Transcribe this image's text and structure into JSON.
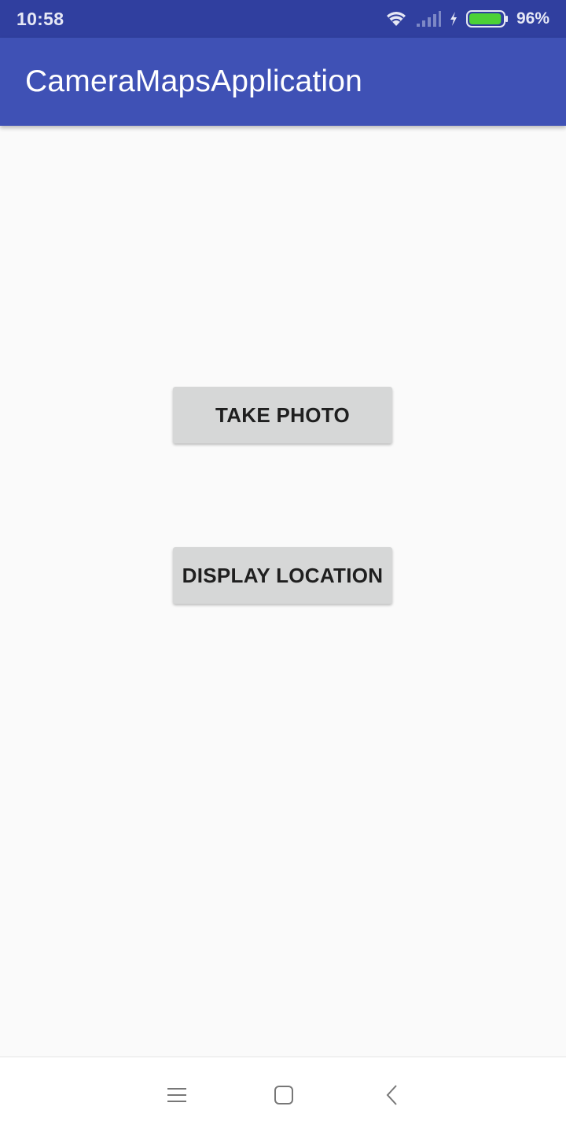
{
  "status_bar": {
    "time": "10:58",
    "battery_percent": "96%",
    "battery_level": 0.96,
    "battery_color": "#4cd137",
    "icons": [
      "wifi-icon",
      "signal-icon",
      "charging-icon",
      "battery-icon"
    ]
  },
  "app_bar": {
    "title": "CameraMapsApplication",
    "color": "#3f51b5"
  },
  "buttons": {
    "take_photo": "TAKE PHOTO",
    "display_location": "DISPLAY LOCATION"
  },
  "nav_bar": {
    "icons": [
      "menu-icon",
      "home-icon",
      "back-icon"
    ]
  }
}
